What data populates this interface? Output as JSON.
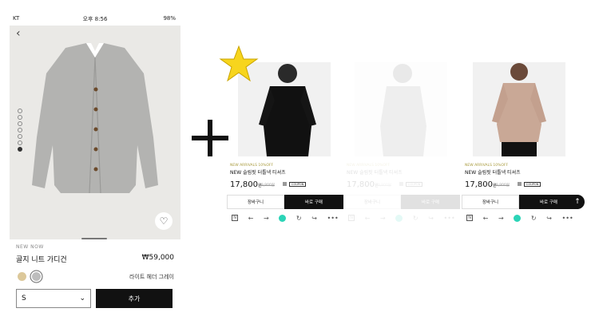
{
  "status_bar": {
    "carrier": "KT",
    "time": "오후 8:56",
    "battery": "98%"
  },
  "product": {
    "tag": "NEW NOW",
    "name": "골지 니트 가디건",
    "price": "₩59,000",
    "color_name": "라이트 헤더 그레이",
    "size": "S",
    "add_label": "추가"
  },
  "panels": [
    {
      "tag": "NEW ARRIVALS 10%OFF",
      "name": "NEW 슬림핏 터틀넥 티셔츠",
      "price": "17,800",
      "currency": "원",
      "old_price": "19,800원",
      "coupon": "COUPON",
      "cart": "장바구니",
      "buy": "바로 구매"
    },
    {
      "tag": "NEW ARRIVALS 10%OFF",
      "name": "NEW 슬림핏 터틀넥 티셔츠",
      "price": "17,800",
      "currency": "원",
      "old_price": "19,800원",
      "coupon": "COUPON",
      "cart": "장바구니",
      "buy": "바로 구매"
    },
    {
      "tag": "NEW ARRIVALS 10%OFF",
      "name": "NEW 슬림핏 터틀넥 티셔츠",
      "price": "17,800",
      "currency": "원",
      "old_price": "19,800원",
      "coupon": "COUPON",
      "cart": "장바구니",
      "buy": "바로 구매"
    }
  ],
  "colors": {
    "accent": "#2bd4b7",
    "star": "#f7d51d",
    "dark": "#111111",
    "swatch_beige": "#dcc89a",
    "swatch_grey": "#bdbdbd"
  },
  "icons": [
    "back-icon",
    "heart-icon",
    "chevron-down-icon",
    "plus-icon",
    "star-icon",
    "n-icon",
    "arrow-left-icon",
    "arrow-right-icon",
    "home-icon",
    "refresh-icon",
    "share-icon",
    "more-icon",
    "scroll-top-icon"
  ]
}
